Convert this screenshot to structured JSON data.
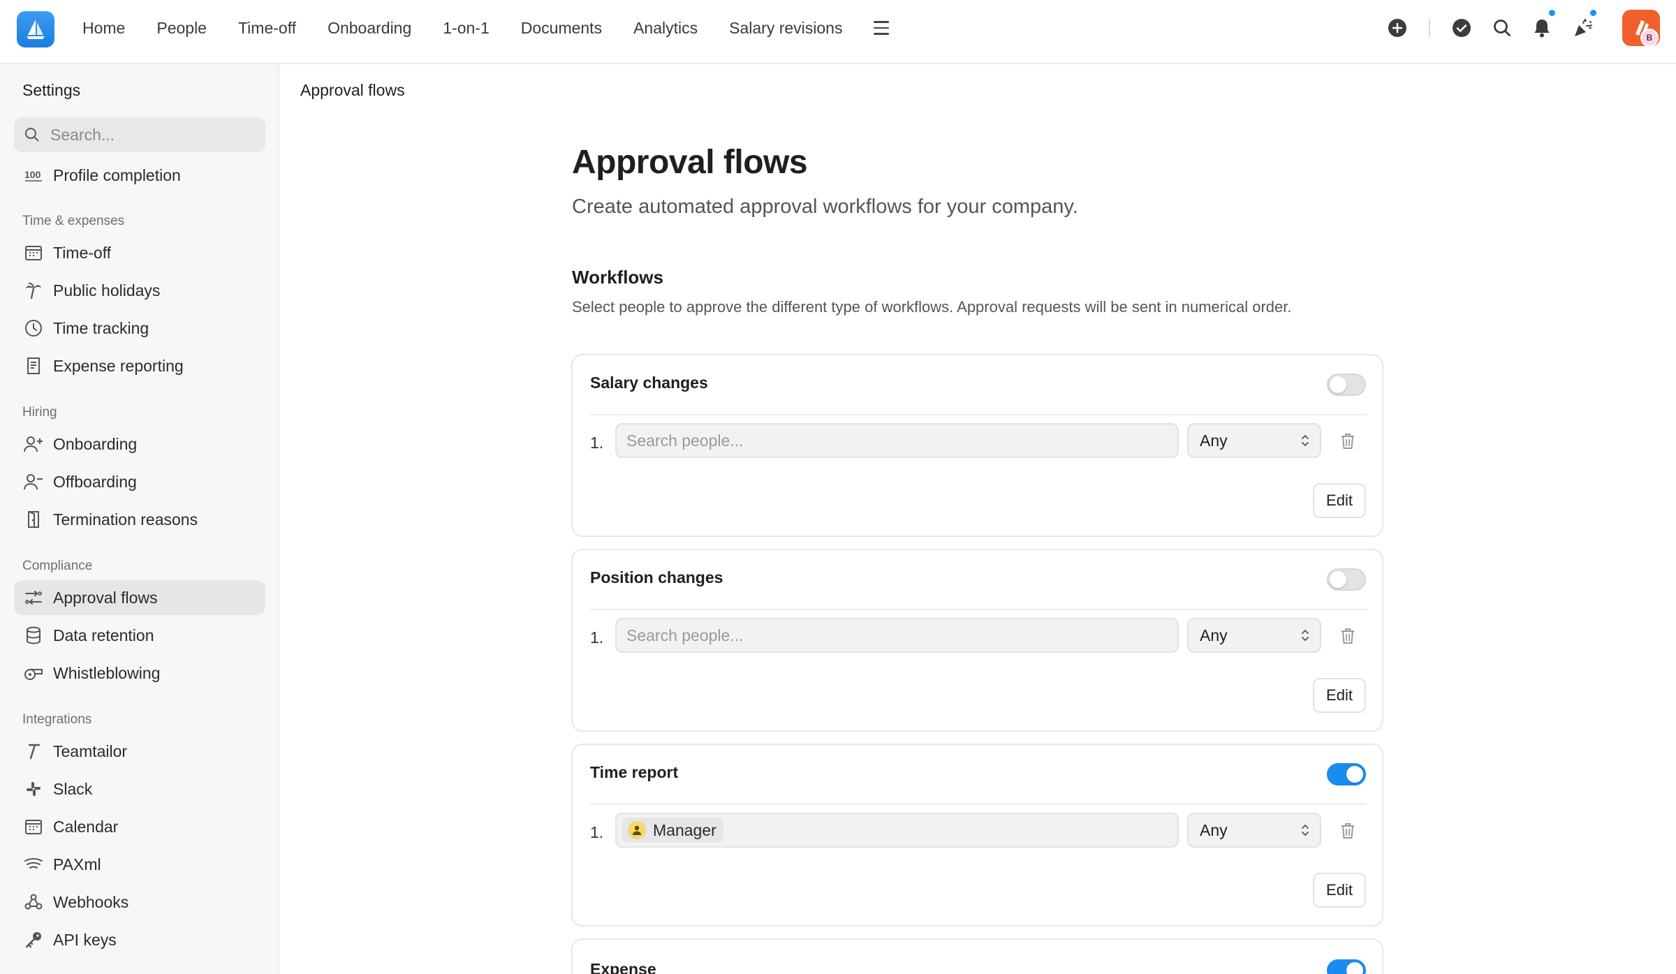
{
  "topnav": {
    "items": [
      "Home",
      "People",
      "Time-off",
      "Onboarding",
      "1-on-1",
      "Documents",
      "Analytics",
      "Salary revisions"
    ],
    "avatar_initial": "B"
  },
  "sidebar": {
    "title": "Settings",
    "search_placeholder": "Search...",
    "profile_completion": "Profile completion",
    "sections": {
      "time_expenses": "Time & expenses",
      "hiring": "Hiring",
      "compliance": "Compliance",
      "integrations": "Integrations"
    },
    "items": {
      "time_off": "Time-off",
      "public_holidays": "Public holidays",
      "time_tracking": "Time tracking",
      "expense_reporting": "Expense reporting",
      "onboarding": "Onboarding",
      "offboarding": "Offboarding",
      "termination_reasons": "Termination reasons",
      "approval_flows": "Approval flows",
      "data_retention": "Data retention",
      "whistleblowing": "Whistleblowing",
      "teamtailor": "Teamtailor",
      "slack": "Slack",
      "calendar": "Calendar",
      "paxml": "PAXml",
      "webhooks": "Webhooks",
      "api_keys": "API keys"
    }
  },
  "main": {
    "breadcrumb": "Approval flows",
    "title": "Approval flows",
    "subtitle": "Create automated approval workflows for your company.",
    "workflows_title": "Workflows",
    "workflows_desc": "Select people to approve the different type of workflows. Approval requests will be sent in numerical order.",
    "cards": [
      {
        "title": "Salary changes",
        "enabled": false,
        "row_num": "1.",
        "placeholder": "Search people...",
        "select": "Any",
        "edit": "Edit"
      },
      {
        "title": "Position changes",
        "enabled": false,
        "row_num": "1.",
        "placeholder": "Search people...",
        "select": "Any",
        "edit": "Edit"
      },
      {
        "title": "Time report",
        "enabled": true,
        "row_num": "1.",
        "chip": "Manager",
        "select": "Any",
        "edit": "Edit"
      },
      {
        "title": "Expense",
        "enabled": true
      }
    ]
  },
  "colors": {
    "accent": "#1a8cf0",
    "brand_logo": "#1a7ee0",
    "avatar": "#f0602c"
  }
}
